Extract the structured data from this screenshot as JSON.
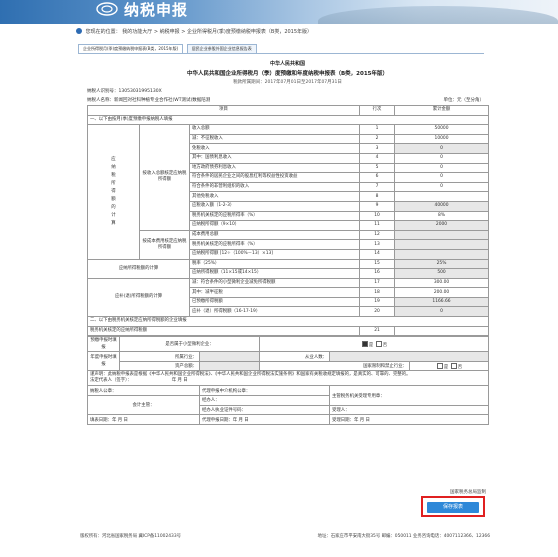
{
  "header": {
    "site_title": "纳税申报"
  },
  "breadcrumb": {
    "prefix": "您现在的位置：",
    "items": [
      "我的功能大厅",
      "纳税申报",
      "企业所得税月(季)度预缴纳税申报表（B类，2015年版）"
    ]
  },
  "tabs": [
    {
      "label": "企业所得税月(季)度预缴纳税申报表(B类，2015年版)"
    },
    {
      "label": "居民企业参股外国企业信息报告表"
    }
  ],
  "form": {
    "title1": "中华人民共和国",
    "title2": "中华人民共和国企业所得税月（季）度预缴和年度纳税申报表（B类，2015年版）",
    "period": "税款所属期间：2017年07月01日至2017年07月31日",
    "taxpayer_id": "纳税人识别号：13053031995130X",
    "taxpayer_name": "纳税人名称：新闻回对社科种植专业合作社(WT测试)数据陪测",
    "unit": "单位：元（至分角）",
    "col_item": "项目",
    "col_row": "行次",
    "col_total": "累计金额",
    "section1": "一、以下由按月(季)度预缴申报纳税人填报",
    "section1_vert": "应纳税所得额的计算",
    "group_income": "按收入总额核定应纳税所得额",
    "group_cost": "按成本费用核定应纳税所得额",
    "group_tax": "应纳所得税额的计算",
    "group_payable": "应补(退)所得税额的计算",
    "rows": [
      {
        "label": "收入总额",
        "no": "1",
        "val": "50000"
      },
      {
        "label": "减：不征税收入",
        "no": "2",
        "val": "10000"
      },
      {
        "label": "免税收入",
        "no": "3",
        "val": "0"
      },
      {
        "label": "其中：国债利息收入",
        "no": "4",
        "val": "0"
      },
      {
        "label": "地方政府债券利息收入",
        "no": "5",
        "val": "0"
      },
      {
        "label": "符合条件的居民企业之间的股息红利等权益性投资收益",
        "no": "6",
        "val": "0"
      },
      {
        "label": "符合条件的非营利组织的收入",
        "no": "7",
        "val": "0"
      },
      {
        "label": "其他免税收入",
        "no": "8",
        "val": ""
      },
      {
        "label": "应税收入额（1-2-3）",
        "no": "9",
        "val": "40000"
      },
      {
        "label": "税务机关核定的应税所得率（%）",
        "no": "10",
        "val": "8%"
      },
      {
        "label": "应纳税所得额（9×10）",
        "no": "11",
        "val": "2000"
      },
      {
        "label": "成本费用总额",
        "no": "12",
        "val": ""
      },
      {
        "label": "税务机关核定的应税所得率（%）",
        "no": "13",
        "val": ""
      },
      {
        "label": "应纳税所得额 [12÷（100%－13）×13]",
        "no": "14",
        "val": ""
      },
      {
        "label": "税率（25%）",
        "no": "15",
        "val": "25%"
      },
      {
        "label": "应纳所得税额（11×15或14×15）",
        "no": "16",
        "val": "500"
      },
      {
        "label": "减：符合条件的小型微利企业减免所得税额",
        "no": "17",
        "val": "300.00"
      },
      {
        "label": "其中：减半征税",
        "no": "18",
        "val": "200.00"
      },
      {
        "label": "已预缴所得税额",
        "no": "19",
        "val": "1166.66"
      },
      {
        "label": "应补（退）所得税额（16-17-19）",
        "no": "20",
        "val": "0"
      }
    ],
    "section2": "二、以下由税务机关核定应纳所得税额的企业填报",
    "row21_label": "税务机关核定的应纳所得税额",
    "row21_no": "21",
    "prepay_label": "预缴申报时填报",
    "small_micro_q": "是否属于小型微利企业：",
    "yes": "是",
    "no": "否",
    "annual_label": "年度申报时填报",
    "industry_label": "所属行业：",
    "employees_label": "从业人数：",
    "assets_label": "资产总额：",
    "restricted_label": "国家限制和禁止行业：",
    "declaration": "谨声明：此纳税申报表是根据《中华人民共和国企业所得税法》、《中华人民共和国企业所得税法实施条例》和国家有关税收规定填报的，是真实的、可靠的、完整的。",
    "legal_rep": "法定代表人（签字）：",
    "date_ymd": "年 月 日",
    "taxpayer_seal": "纳税人公章：",
    "agent_seal": "代理申报中介机构公章：",
    "tax_authority": "主管税务机关受理专用章：",
    "manager": "经办人：",
    "accountant": "会计主管：",
    "agent_id": "经办人执业证件号码：",
    "receiver": "受理人：",
    "fill_date": "填表日期：年 月 日",
    "agent_date": "代理申报日期：年 月 日",
    "receive_date": "受理日期：年 月 日"
  },
  "office_note": "国家税务总局监制",
  "actions": {
    "submit_label": "保存报表"
  },
  "footer": {
    "left": "版权所有：河北省国家税务局 冀ICP备11002433号",
    "right": "地址：石家庄市平安南大街35号 邮编：050011 业务咨询电话：4007112366、12366"
  }
}
